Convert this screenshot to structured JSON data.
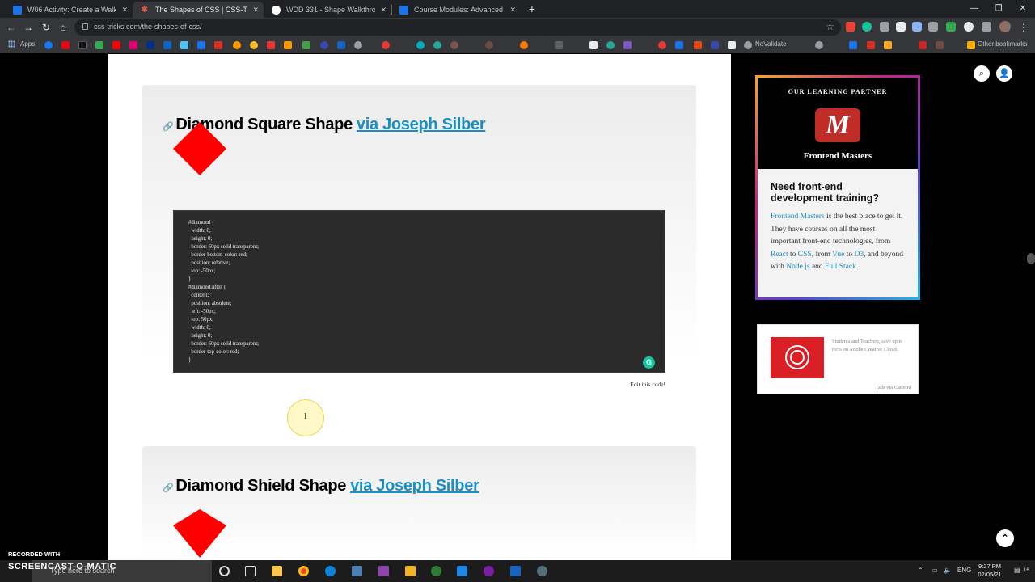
{
  "browser": {
    "tabs": [
      {
        "title": "W06 Activity: Create a Walk-thro",
        "color": "#1a73e8"
      },
      {
        "title": "The Shapes of CSS | CSS-Tricks",
        "color": "#e05a47"
      },
      {
        "title": "WDD 331 - Shape Walkthrough",
        "color": "#9aa0a6"
      },
      {
        "title": "Course Modules: Advanced CSS",
        "color": "#1a73e8"
      }
    ],
    "url": "css-tricks.com/the-shapes-of-css/",
    "bookmarks_apps": "Apps",
    "bookmark_novalidate": "NoValidate",
    "other_bookmarks": "Other bookmarks"
  },
  "main": {
    "card1": {
      "title": "Diamond Square Shape",
      "via": "via Joseph Silber",
      "code": "#diamond {\n  width: 0;\n  height: 0;\n  border: 50px solid transparent;\n  border-bottom-color: red;\n  position: relative;\n  top: -50px;\n}\n#diamond:after {\n  content: '';\n  position: absolute;\n  left: -50px;\n  top: 50px;\n  width: 0;\n  height: 0;\n  border: 50px solid transparent;\n  border-top-color: red;\n}",
      "edit_label": "Edit this code!"
    },
    "card2": {
      "title": "Diamond Shield Shape",
      "via": "via Joseph Silber"
    },
    "shape_color": "#ff0000"
  },
  "sidebar": {
    "partner": {
      "kicker": "OUR LEARNING PARTNER",
      "logo_letter": "M",
      "name": "Frontend Masters",
      "heading": "Need front-end development training?",
      "link_fm": "Frontend Masters",
      "text_1": " is the best place to get it. They have courses on all the most important front-end technologies, from ",
      "link_react": "React",
      "text_to1": " to ",
      "link_css": "CSS",
      "text_2": ", from ",
      "link_vue": "Vue",
      "text_to2": " to ",
      "link_d3": "D3",
      "text_3": ", and beyond with ",
      "link_node": "Node.js",
      "text_and": " and ",
      "link_fullstack": "Full Stack",
      "text_end": "."
    },
    "carbon": {
      "text": "Students and Teachers, save up to 60% on Adobe Creative Cloud.",
      "via": "(ads via Carbon)"
    }
  },
  "taskbar": {
    "search_placeholder": "Type here to search",
    "lang": "ENG",
    "time": "9:27 PM",
    "date": "02/05/21",
    "notif_count": "16"
  },
  "watermark": {
    "line1": "RECORDED WITH",
    "line2": "SCREENCAST-O-MATIC"
  }
}
